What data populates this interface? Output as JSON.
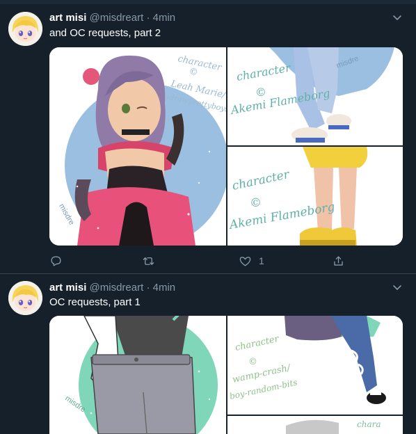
{
  "tweets": [
    {
      "display_name": "art misi",
      "handle": "@misdreart",
      "separator": "·",
      "time": "4min",
      "text": "and OC requests, part 2",
      "images": [
        {
          "watermark": "misdre",
          "credit_lines": [
            "character",
            "©",
            "Leah Marie/",
            "idrawprettyboys"
          ]
        },
        {
          "watermark": "misdre",
          "credit_lines": [
            "character",
            "©",
            "Akemi Flameborg"
          ]
        },
        {
          "credit_lines": [
            "character",
            "©",
            "Akemi Flameborg"
          ]
        }
      ],
      "like_count": "1"
    },
    {
      "display_name": "art misi",
      "handle": "@misdreart",
      "separator": "·",
      "time": "4min",
      "text": "OC requests, part 1",
      "images": [
        {
          "watermark": "misdre"
        },
        {
          "credit_lines": [
            "character",
            "©",
            "wamp-crash/",
            "boy-random-bits"
          ]
        },
        {
          "credit_lines": [
            "chara"
          ]
        }
      ]
    }
  ],
  "icons": {
    "reply": "reply-icon",
    "retweet": "retweet-icon",
    "like": "like-icon",
    "share": "share-icon",
    "more": "chevron-down-icon"
  },
  "colors": {
    "background": "#15202b",
    "divider": "#38444d",
    "secondary_text": "#8899a6",
    "art_blue": "#9bbfe0",
    "art_mint": "#7fd6b8",
    "credit_teal": "#5fb0a8"
  }
}
